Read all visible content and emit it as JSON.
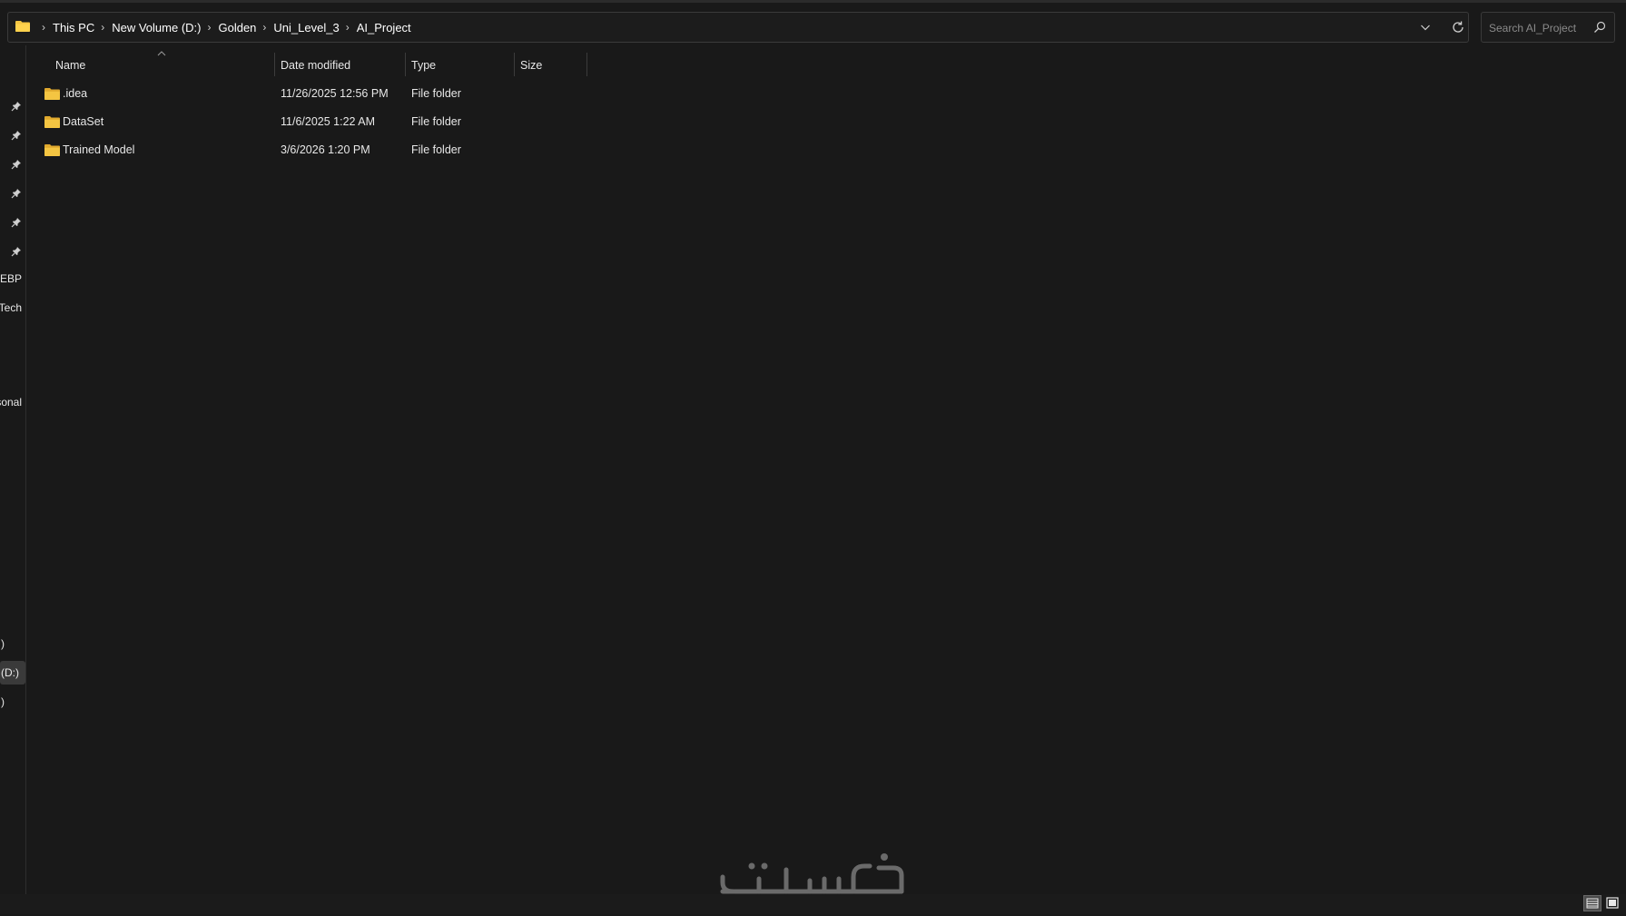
{
  "address_bar": {
    "breadcrumbs": [
      "This PC",
      "New Volume (D:)",
      "Golden",
      "Uni_Level_3",
      "AI_Project"
    ],
    "folder_icon": "folder-icon",
    "dropdown_icon": "chevron-down-icon",
    "refresh_icon": "refresh-icon"
  },
  "search": {
    "placeholder": "Search AI_Project",
    "icon": "search-icon"
  },
  "navigation_pane": {
    "pinned_count": 6,
    "items": [
      "EBP",
      "Tech",
      "sonal",
      ")",
      "(D:)",
      ")"
    ],
    "selected_item": "(D:)"
  },
  "columns": {
    "name": "Name",
    "date_modified": "Date modified",
    "type": "Type",
    "size": "Size",
    "sorted_by": "Name",
    "sort_direction": "ascending"
  },
  "files": [
    {
      "name": ".idea",
      "date_modified": "11/26/2025 12:56 PM",
      "type": "File folder",
      "size": ""
    },
    {
      "name": "DataSet",
      "date_modified": "11/6/2025 1:22 AM",
      "type": "File folder",
      "size": ""
    },
    {
      "name": "Trained Model",
      "date_modified": "3/6/2026 1:20 PM",
      "type": "File folder",
      "size": ""
    }
  ],
  "status_bar": {
    "view_buttons": [
      "details-view-icon",
      "large-icons-view-icon"
    ],
    "active_view": "details"
  },
  "watermark": "خمسات",
  "colors": {
    "background": "#191919",
    "folder": "#f4c542",
    "text": "#e8e8e8"
  }
}
